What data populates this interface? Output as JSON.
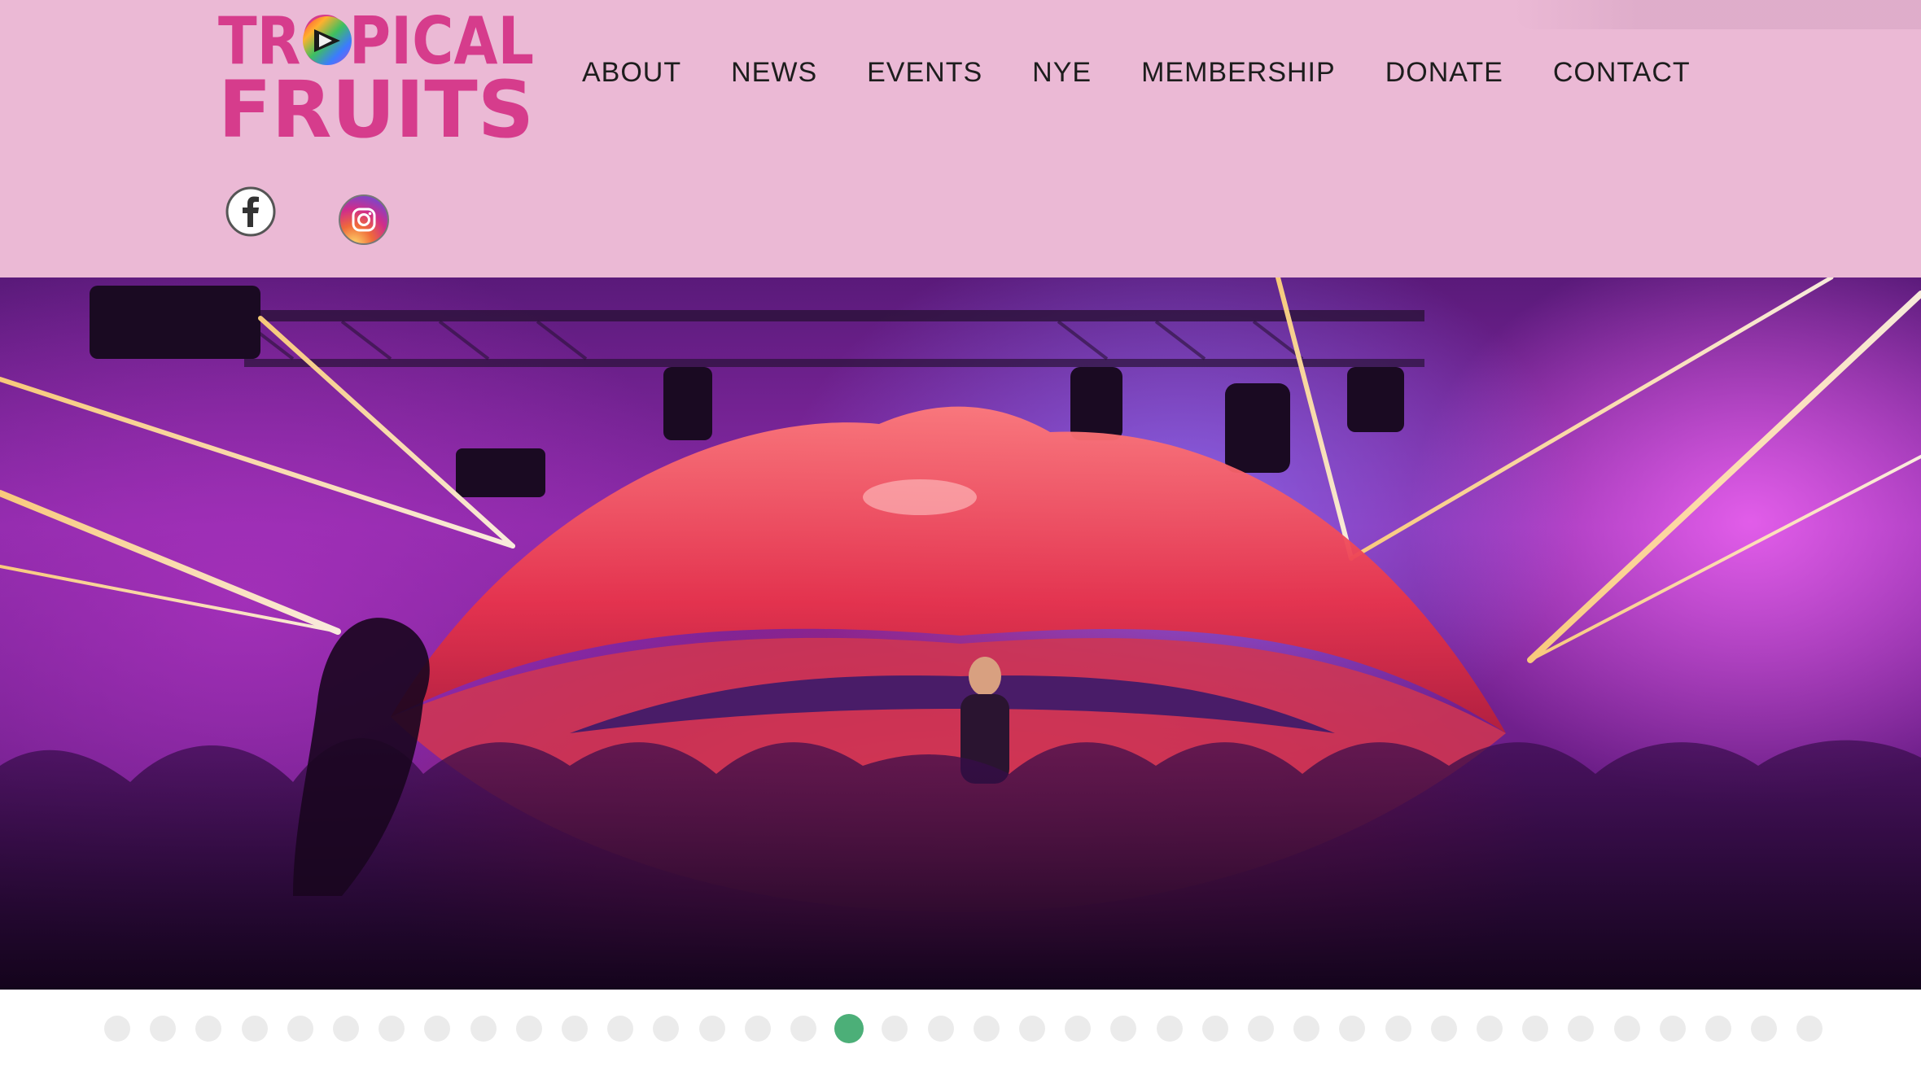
{
  "brand": {
    "logo_line1": "TROPICAL",
    "logo_line2": "FRUITS",
    "logo_color": "#d63c8c"
  },
  "nav": {
    "items": [
      "ABOUT",
      "NEWS",
      "EVENTS",
      "NYE",
      "MEMBERSHIP",
      "DONATE",
      "CONTACT"
    ]
  },
  "social": {
    "icons": [
      "facebook-icon",
      "instagram-icon"
    ]
  },
  "slider": {
    "slide_count": 38,
    "active_slide": 16,
    "active_color": "#4caf78",
    "inactive_color": "#ebebeb"
  },
  "colors": {
    "header_bg": "#ebb9d5",
    "nav_text": "#1d1d1d"
  }
}
